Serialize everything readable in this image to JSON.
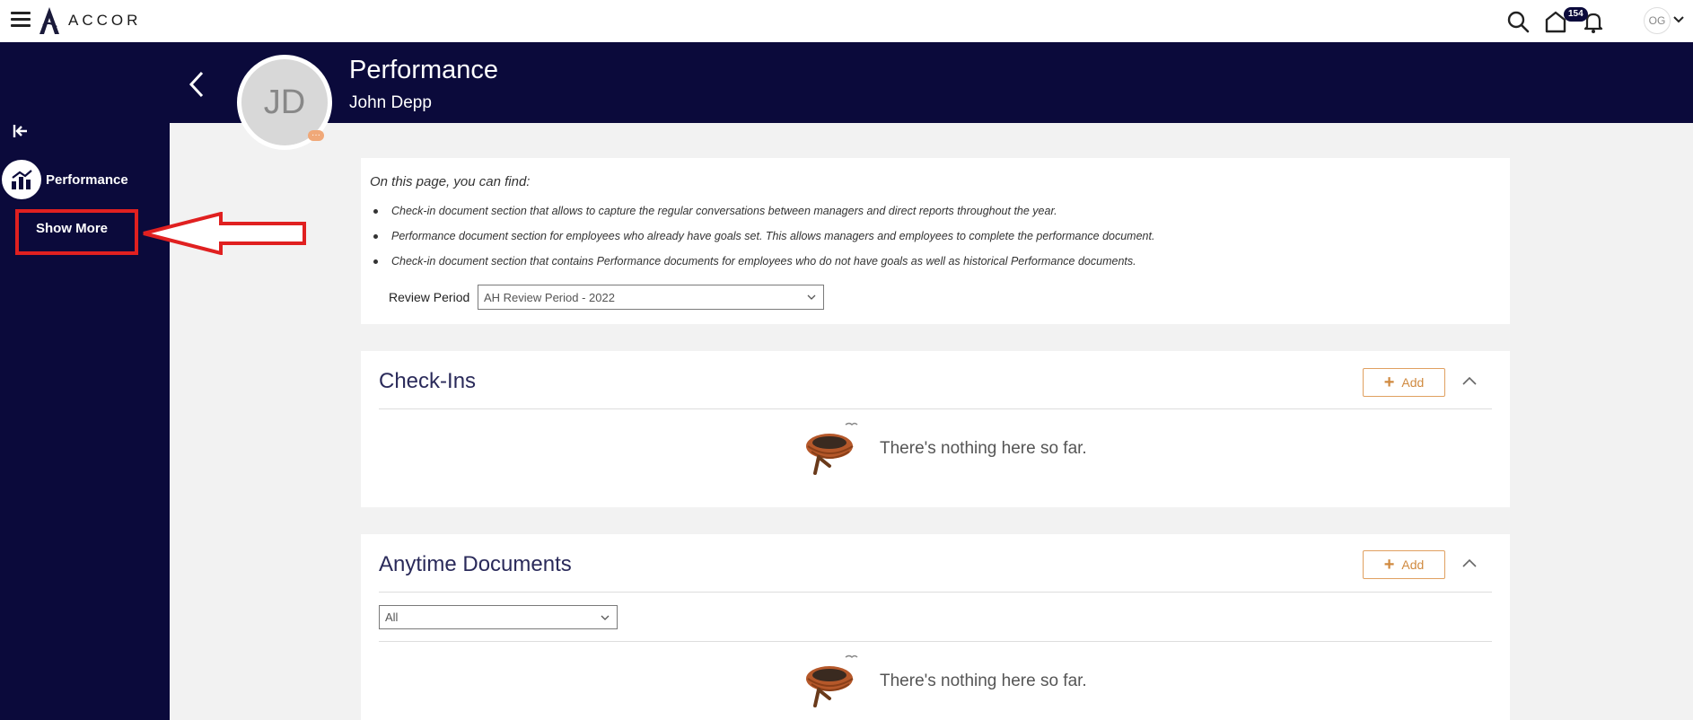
{
  "topbar": {
    "brand": "ACCOR",
    "notification_count": "154",
    "user_initials": "OG"
  },
  "header": {
    "avatar_initials": "JD",
    "avatar_badge": "···",
    "title": "Performance",
    "subtitle": "John Depp"
  },
  "sidebar": {
    "performance_label": "Performance",
    "show_more_label": "Show More"
  },
  "info": {
    "intro": "On this page, you can find:",
    "bullets": [
      "Check-in document section that allows to capture the regular conversations between managers and direct reports throughout the year.",
      "Performance document section for employees who already have goals set. This allows managers and employees to complete the performance document.",
      "Check-in document section that contains Performance documents for employees who do not have goals as well as historical Performance documents."
    ],
    "review_period_label": "Review Period",
    "review_period_value": "AH Review Period - 2022"
  },
  "checkins": {
    "title": "Check-Ins",
    "add_label": "Add",
    "empty_text": "There's nothing here so far."
  },
  "anytime": {
    "title": "Anytime Documents",
    "add_label": "Add",
    "filter_value": "All",
    "empty_text": "There's nothing here so far."
  },
  "colors": {
    "navy": "#0b0a3b",
    "accent_orange": "#d08a40",
    "annotation_red": "#e02020"
  }
}
